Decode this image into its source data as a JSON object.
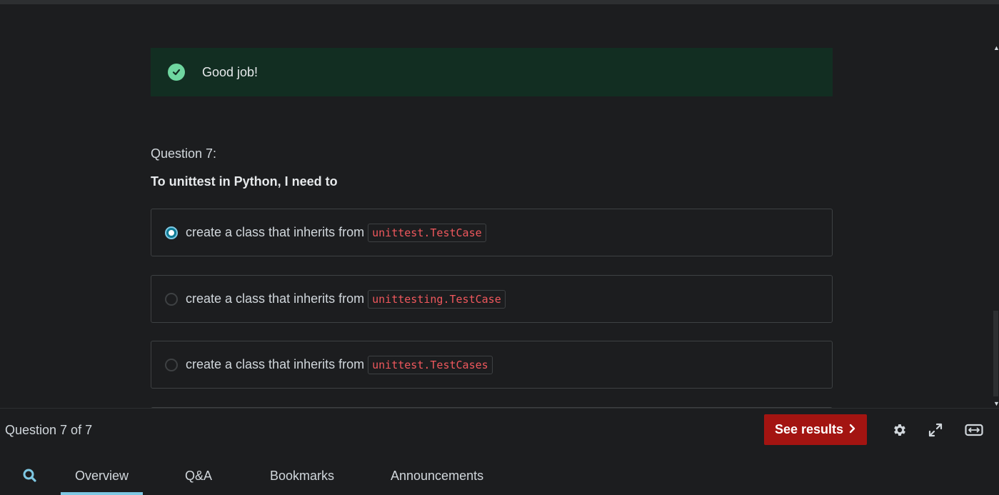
{
  "alert": {
    "message": "Good job!"
  },
  "question": {
    "number_label": "Question 7:",
    "prompt": "To unittest in Python, I need to",
    "options": [
      {
        "text": "create a class that inherits from",
        "code": "unittest.TestCase",
        "selected": true
      },
      {
        "text": "create a class that inherits from",
        "code": "unittesting.TestCase",
        "selected": false
      },
      {
        "text": "create a class that inherits from",
        "code": "unittest.TestCases",
        "selected": false
      }
    ]
  },
  "footer": {
    "progress": "Question 7 of 7",
    "see_results_label": "See results",
    "icons": [
      "gear-icon",
      "expand-icon",
      "widescreen-icon"
    ]
  },
  "tabs": {
    "items": [
      "Overview",
      "Q&A",
      "Bookmarks",
      "Announcements"
    ],
    "active": "Overview"
  },
  "colors": {
    "alert_bg": "#122e22",
    "alert_check": "#6fd6a0",
    "code_text": "#f0585d",
    "see_results_bg": "#a31411",
    "active_tab_underline": "#7ec8e3",
    "selected_radio": "#0d7a94"
  }
}
